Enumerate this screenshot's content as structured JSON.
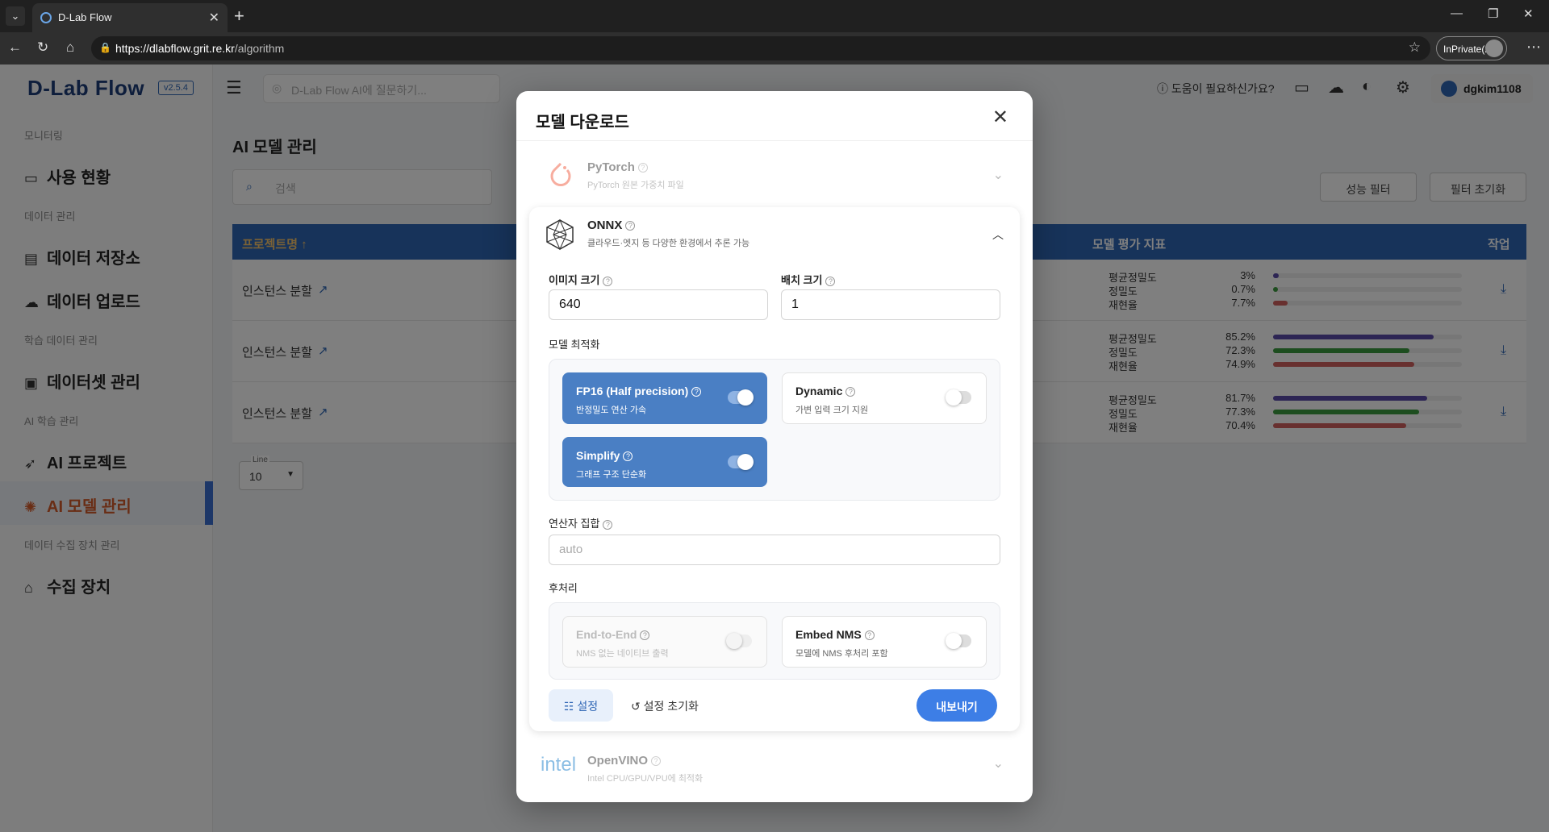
{
  "browser": {
    "tab_title": "D-Lab Flow",
    "url_host": "https://dlabflow.grit.re.kr",
    "url_path": "/algorithm",
    "inprivate": "InPrivate(2)"
  },
  "app": {
    "logo": "D-Lab Flow",
    "version": "v2.5.4",
    "ask_placeholder": "D-Lab Flow AI에 질문하기...",
    "help": "도움이 필요하신가요?",
    "user": "dgkim1108"
  },
  "sidebar": {
    "sections": [
      {
        "label": "모니터링"
      },
      {
        "label": "데이터 관리"
      },
      {
        "label": "학습 데이터 관리"
      },
      {
        "label": "AI 학습 관리"
      },
      {
        "label": "데이터 수집 장치 관리"
      }
    ],
    "items": [
      {
        "label": "사용 현황"
      },
      {
        "label": "데이터 저장소"
      },
      {
        "label": "데이터 업로드"
      },
      {
        "label": "데이터셋 관리"
      },
      {
        "label": "AI 프로젝트"
      },
      {
        "label": "AI 모델 관리"
      },
      {
        "label": "수집 장치"
      }
    ]
  },
  "page": {
    "title": "AI 모델 관리",
    "search_placeholder": "검색",
    "perf_filter": "성능 필터",
    "filter_reset": "필터 초기화",
    "columns": {
      "project": "프로젝트명 ↑",
      "metrics": "모델 평가 지표",
      "action": "작업"
    },
    "metric_labels": [
      "평균정밀도",
      "정밀도",
      "재현율"
    ],
    "rows": [
      {
        "name": "인스턴스 분할",
        "values": [
          "3%",
          "0.7%",
          "7.7%"
        ],
        "fractions": [
          0.03,
          0.007,
          0.077
        ]
      },
      {
        "name": "인스턴스 분할",
        "values": [
          "85.2%",
          "72.3%",
          "74.9%"
        ],
        "fractions": [
          0.852,
          0.723,
          0.749
        ]
      },
      {
        "name": "인스턴스 분할",
        "values": [
          "81.7%",
          "77.3%",
          "70.4%"
        ],
        "fractions": [
          0.817,
          0.773,
          0.704
        ]
      }
    ],
    "line_label": "Line",
    "line_value": "10"
  },
  "modal": {
    "title": "모델 다운로드",
    "pytorch": {
      "name": "PyTorch",
      "desc": "PyTorch 원본 가중치 파일"
    },
    "onnx": {
      "name": "ONNX",
      "desc": "클라우드·엣지 등 다양한 환경에서 추론 가능",
      "image_size_label": "이미지 크기",
      "image_size": "640",
      "batch_label": "배치 크기",
      "batch": "1",
      "optimize_label": "모델 최적화",
      "fp16": {
        "name": "FP16 (Half precision)",
        "desc": "반정밀도 연산 가속"
      },
      "dynamic": {
        "name": "Dynamic",
        "desc": "가변 입력 크기 지원"
      },
      "simplify": {
        "name": "Simplify",
        "desc": "그래프 구조 단순화"
      },
      "opset_label": "연산자 집합",
      "opset_placeholder": "auto",
      "post_label": "후처리",
      "e2e": {
        "name": "End-to-End",
        "desc": "NMS 없는 네이티브 출력"
      },
      "nms": {
        "name": "Embed NMS",
        "desc": "모델에 NMS 후처리 포함"
      },
      "settings": "설정",
      "reset": "설정 초기화",
      "export": "내보내기"
    },
    "openvino": {
      "logo": "intel",
      "name": "OpenVINO",
      "desc": "Intel CPU/GPU/VPU에 최적화"
    }
  },
  "colors": {
    "primary": "#2f66b5",
    "bar_ap": "#5b4aa8",
    "bar_p": "#3a9a3e",
    "bar_r": "#d0605e"
  }
}
